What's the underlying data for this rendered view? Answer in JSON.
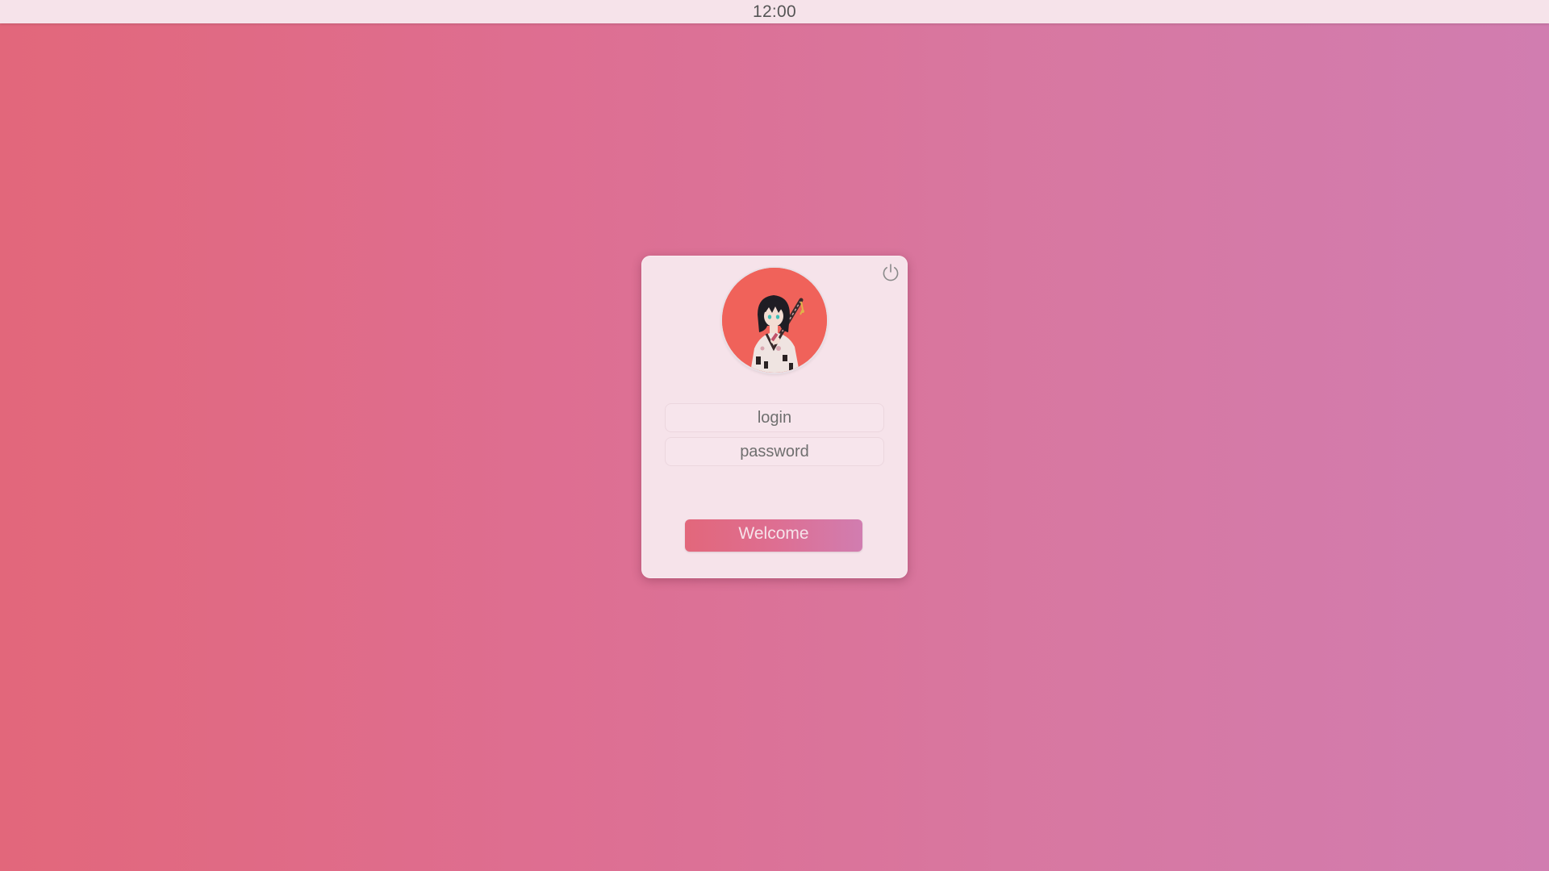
{
  "top_bar": {
    "clock": "12:00"
  },
  "login_card": {
    "avatar_icon": "anime-samurai-avatar",
    "power_icon": "power-icon",
    "login_field": {
      "value": "",
      "placeholder": "login"
    },
    "password_field": {
      "value": "",
      "placeholder": "password"
    },
    "submit_label": "Welcome"
  },
  "colors": {
    "background_start": "#e2677b",
    "background_end": "#d17db0",
    "card": "#f6e3ea",
    "avatar_bg": "#f0625a",
    "button_text": "#f6e3ea"
  }
}
